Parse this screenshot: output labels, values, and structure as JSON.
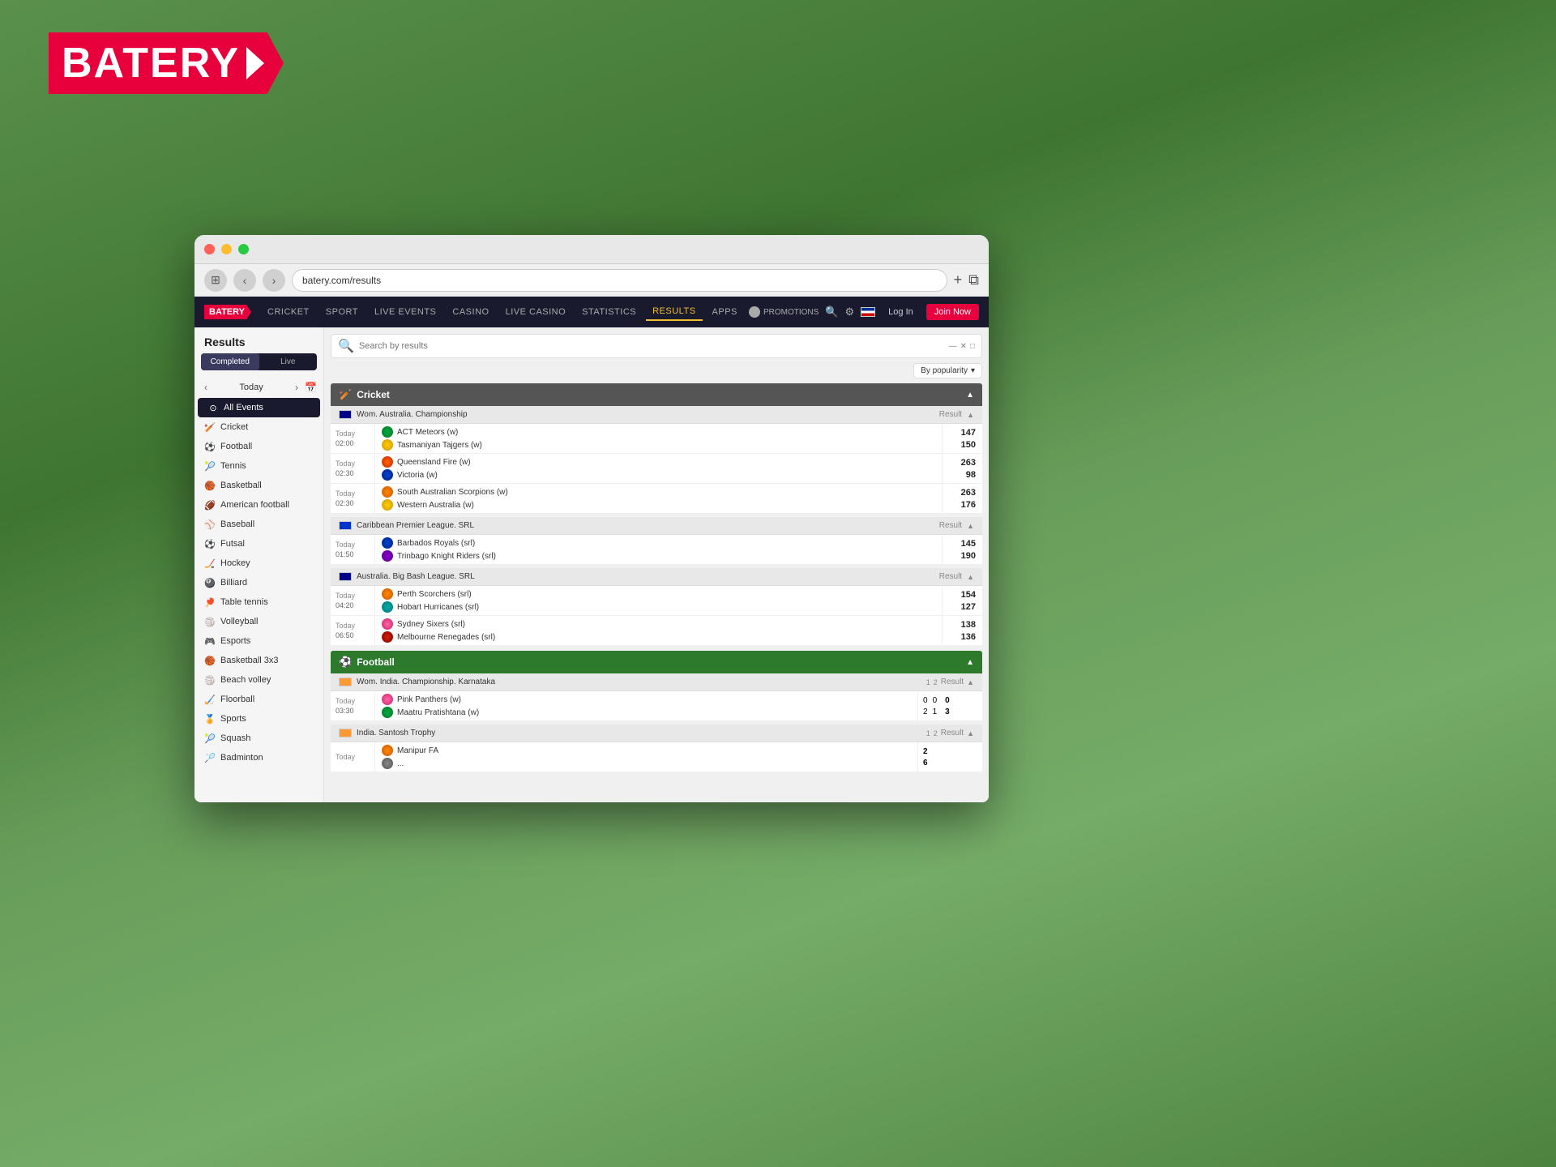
{
  "background": {
    "type": "cricket field"
  },
  "logo": {
    "text": "BATERY",
    "arrow": "»"
  },
  "browser": {
    "address": "batery.com/results",
    "tabs_icon": "⊞",
    "back": "‹",
    "forward": "›"
  },
  "site": {
    "nav": {
      "cricket": "CRICKET",
      "sport": "SPORT",
      "live_events": "LIVE EVENTS",
      "casino": "CASINO",
      "live_casino": "LIVE CASINO",
      "statistics": "STATISTICS",
      "results": "RESULTS",
      "apps": "APPS"
    },
    "header_right": {
      "promotions": "PROMOTIONS",
      "login": "Log In",
      "join": "Join Now"
    }
  },
  "results_page": {
    "title": "Results",
    "tabs": {
      "completed": "Completed",
      "live": "Live"
    },
    "date_nav": {
      "today": "Today",
      "prev": "‹",
      "next": "›"
    },
    "sidebar_all_events": "All Events",
    "sidebar_items": [
      {
        "label": "Cricket",
        "icon": "🏏"
      },
      {
        "label": "Football",
        "icon": "⚽"
      },
      {
        "label": "Tennis",
        "icon": "🎾"
      },
      {
        "label": "Basketball",
        "icon": "🏀"
      },
      {
        "label": "American football",
        "icon": "🏈"
      },
      {
        "label": "Baseball",
        "icon": "⚾"
      },
      {
        "label": "Futsal",
        "icon": "⚽"
      },
      {
        "label": "Hockey",
        "icon": "🏒"
      },
      {
        "label": "Billiard",
        "icon": "🎱"
      },
      {
        "label": "Table tennis",
        "icon": "🏓"
      },
      {
        "label": "Volleyball",
        "icon": "🏐"
      },
      {
        "label": "Esports",
        "icon": "🎮"
      },
      {
        "label": "Basketball 3x3",
        "icon": "🏀"
      },
      {
        "label": "Beach volley",
        "icon": "🏐"
      },
      {
        "label": "Floorball",
        "icon": "🏑"
      },
      {
        "label": "Sports",
        "icon": "🏅"
      },
      {
        "label": "Squash",
        "icon": "🎾"
      },
      {
        "label": "Badminton",
        "icon": "🏸"
      }
    ],
    "search_placeholder": "Search by results",
    "sort_label": "By popularity",
    "cricket": {
      "section_title": "Cricket",
      "leagues": [
        {
          "name": "Wom. Australia. Championship",
          "flag": "aus",
          "result_label": "Result",
          "matches": [
            {
              "day": "Today",
              "time": "02:00",
              "team1": "ACT Meteors (w)",
              "team2": "Tasmaniyan Tajgers (w)",
              "logo1": "green",
              "logo2": "yellow",
              "score1": "147",
              "score2": "150"
            },
            {
              "day": "Today",
              "time": "02:30",
              "team1": "Queensland Fire (w)",
              "team2": "Victoria (w)",
              "logo1": "fire",
              "logo2": "blue",
              "score1": "263",
              "score2": "98"
            },
            {
              "day": "Today",
              "time": "02:30",
              "team1": "South Australian Scorpions (w)",
              "team2": "Western Australia (w)",
              "logo1": "orange",
              "logo2": "yellow",
              "score1": "263",
              "score2": "176"
            }
          ]
        },
        {
          "name": "Caribbean Premier League. SRL",
          "flag": "carib",
          "result_label": "Result",
          "matches": [
            {
              "day": "Today",
              "time": "01:50",
              "team1": "Barbados Royals (srl)",
              "team2": "Trinbago Knight Riders (srl)",
              "logo1": "blue",
              "logo2": "purple",
              "score1": "145",
              "score2": "190"
            }
          ]
        },
        {
          "name": "Australia. Big Bash League. SRL",
          "flag": "aus",
          "result_label": "Result",
          "matches": [
            {
              "day": "Today",
              "time": "04:20",
              "team1": "Perth Scorchers (srl)",
              "team2": "Hobart Hurricanes (srl)",
              "logo1": "orange",
              "logo2": "teal",
              "score1": "154",
              "score2": "127"
            },
            {
              "day": "Today",
              "time": "06:50",
              "team1": "Sydney Sixers (srl)",
              "team2": "Melbourne Renegades (srl)",
              "logo1": "pink",
              "logo2": "red",
              "score1": "138",
              "score2": "136"
            }
          ]
        }
      ]
    },
    "football": {
      "section_title": "Football",
      "leagues": [
        {
          "name": "Wom. India. Championship. Karnataka",
          "flag": "india",
          "col1": "1",
          "col2": "2",
          "result_label": "Result",
          "matches": [
            {
              "day": "Today",
              "time": "03:30",
              "team1": "Pink Panthers (w)",
              "team2": "Maatru Pratishtana (w)",
              "logo1": "pink",
              "logo2": "green",
              "s1_1": "0",
              "s1_2": "0",
              "s2_1": "2",
              "s2_2": "1",
              "result1": "0",
              "result2": "3"
            }
          ]
        },
        {
          "name": "India. Santosh Trophy",
          "flag": "india",
          "col1": "1",
          "col2": "2",
          "result_label": "Result",
          "matches": [
            {
              "day": "Today",
              "time": "??",
              "team1": "Manipur FA",
              "team2": "...",
              "logo1": "orange",
              "logo2": "gray",
              "s1_1": "?",
              "s1_2": "?",
              "s2_1": "?",
              "s2_2": "?",
              "result1": "2",
              "result2": "6"
            }
          ]
        }
      ]
    }
  }
}
